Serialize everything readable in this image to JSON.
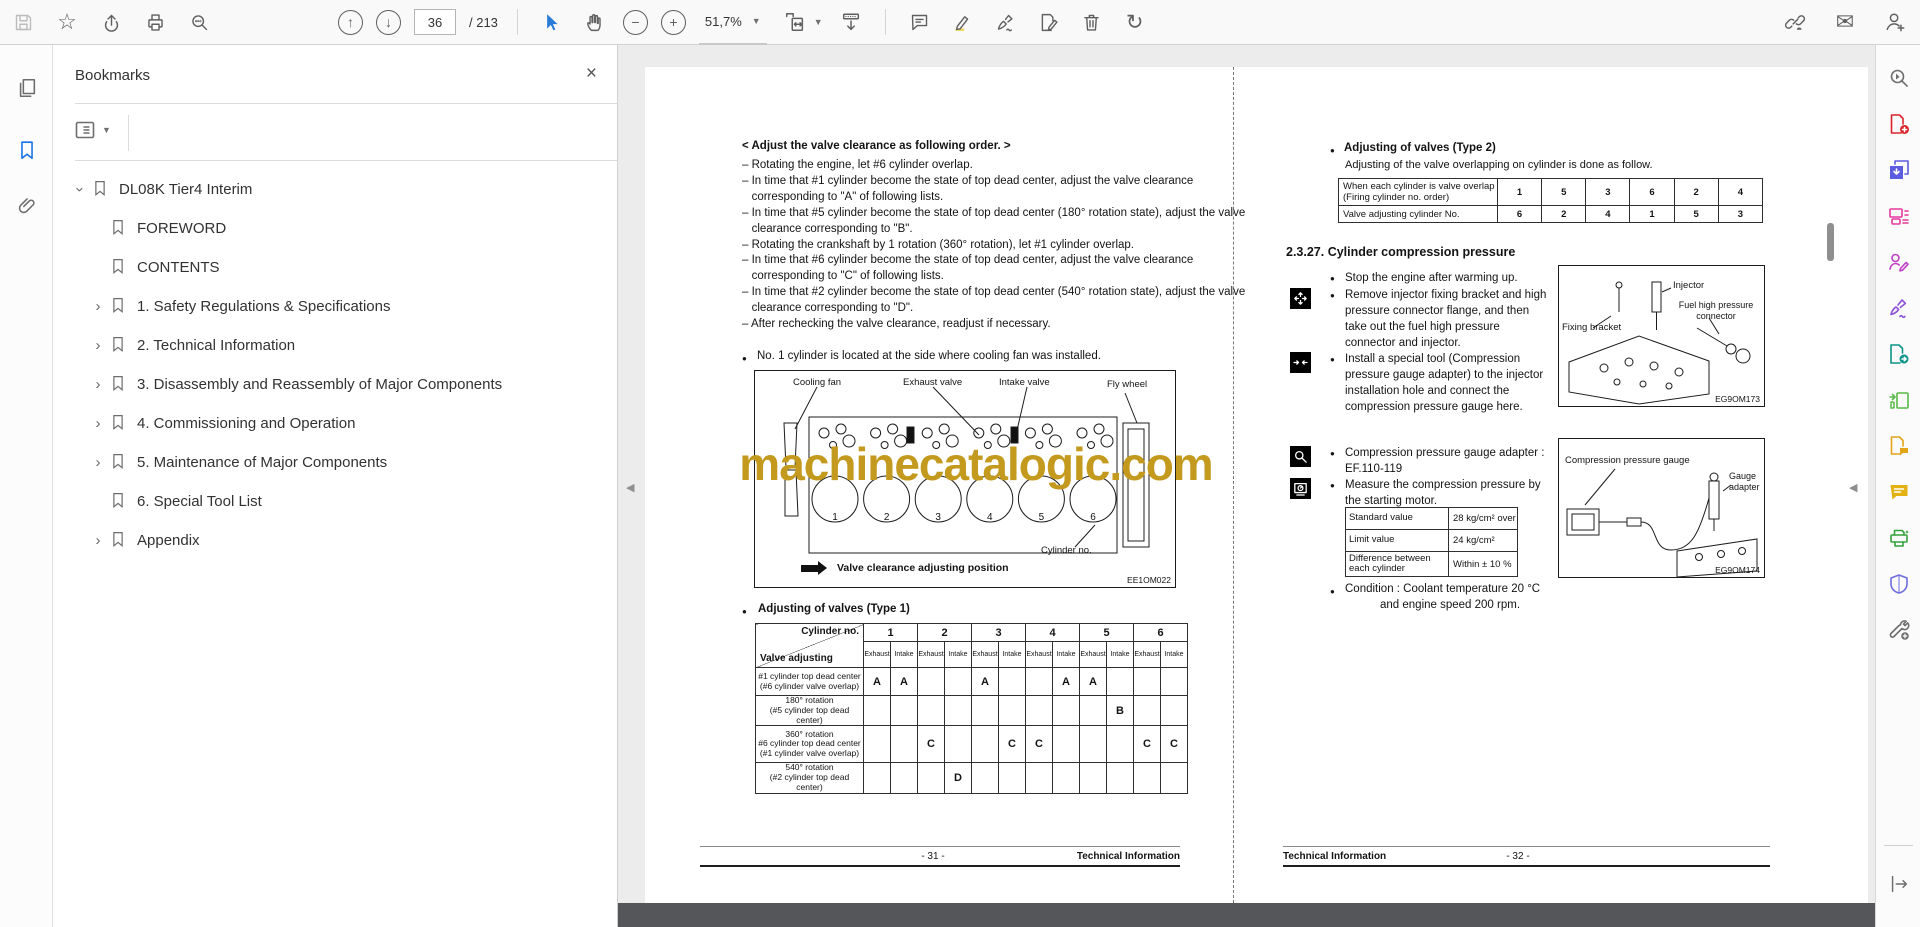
{
  "toolbar": {
    "page_current": "36",
    "page_total": "/ 213",
    "zoom_level": "51,7%",
    "left_icons": [
      "save-icon",
      "star-icon",
      "share-icon",
      "print-icon",
      "search-icon"
    ],
    "center_icons": [
      "page-up-icon",
      "page-down-icon",
      "select-tool-icon",
      "hand-tool-icon",
      "zoom-out-icon",
      "zoom-in-icon",
      "fit-width-icon",
      "scroll-mode-icon",
      "comment-icon",
      "highlight-icon",
      "sign-icon",
      "fill-sign-icon",
      "delete-icon",
      "rotate-icon"
    ],
    "right_icons": [
      "share-link-icon",
      "email-icon",
      "account-icon"
    ]
  },
  "left_rail": {
    "icons": [
      "page-thumbnails-icon",
      "bookmarks-icon",
      "attachments-icon"
    ],
    "active": "bookmarks-icon"
  },
  "bookmarks_panel": {
    "title": "Bookmarks",
    "close_label": "×",
    "items": [
      {
        "label": "DL08K Tier4 Interim",
        "chevron": "expanded",
        "indent": 0
      },
      {
        "label": "FOREWORD",
        "chevron": "none",
        "indent": 1
      },
      {
        "label": "CONTENTS",
        "chevron": "none",
        "indent": 1
      },
      {
        "label": "1. Safety Regulations & Specifications",
        "chevron": "collapsed",
        "indent": 1
      },
      {
        "label": "2. Technical Information",
        "chevron": "collapsed",
        "indent": 1
      },
      {
        "label": "3. Disassembly and Reassembly of Major Components",
        "chevron": "collapsed",
        "indent": 1
      },
      {
        "label": "4. Commissioning and Operation",
        "chevron": "collapsed",
        "indent": 1
      },
      {
        "label": "5. Maintenance of Major Components",
        "chevron": "collapsed",
        "indent": 1
      },
      {
        "label": "6. Special Tool List",
        "chevron": "none",
        "indent": 1
      },
      {
        "label": "Appendix",
        "chevron": "collapsed",
        "indent": 1
      }
    ]
  },
  "watermark": "machinecatalogic.com",
  "left_page": {
    "heading": "< Adjust the valve clearance as following order. >",
    "intro_lines": [
      "– Rotating the engine, let #6 cylinder overlap.",
      "– In time that #1 cylinder become the state of top dead center, adjust the valve clearance",
      "   corresponding to \"A\" of following lists.",
      "– In time that #5 cylinder become the state of top dead center (180° rotation state), adjust the valve",
      "   clearance corresponding to \"B\".",
      "– Rotating the crankshaft by 1 rotation (360° rotation), let #1 cylinder overlap.",
      "– In time that #6 cylinder become the state of top dead center, adjust the valve clearance",
      "   corresponding to \"C\" of following lists.",
      "– In time that #2 cylinder become the state of top dead center (540° rotation state), adjust the valve",
      "   clearance corresponding to \"D\".",
      "– After rechecking the valve clearance, readjust if necessary."
    ],
    "note": "No. 1 cylinder is located at the side where cooling fan was installed.",
    "figure": {
      "labels": {
        "cooling_fan": "Cooling fan",
        "exhaust_valve": "Exhaust valve",
        "intake_valve": "Intake valve",
        "fly_wheel": "Fly wheel",
        "cylinder_no": "Cylinder no."
      },
      "cylinder_numbers": [
        "1",
        "2",
        "3",
        "4",
        "5",
        "6"
      ],
      "caption": "Valve clearance adjusting position",
      "code": "EE1OM022"
    },
    "type1_table": {
      "title": "Adjusting of valves (Type 1)",
      "corner_top": "Cylinder no.",
      "corner_bottom": "Valve adjusting",
      "cylinders": [
        "1",
        "2",
        "3",
        "4",
        "5",
        "6"
      ],
      "subheaders": [
        "Exhaust",
        "Intake"
      ],
      "rows": [
        {
          "label_lines": [
            "#1 cylinder top dead center",
            "(#6 cylinder valve overlap)"
          ],
          "marks": [
            "A",
            "A",
            "",
            "",
            "A",
            "",
            "",
            "A",
            "A",
            "",
            "",
            ""
          ]
        },
        {
          "label_lines": [
            "180° rotation",
            "(#5 cylinder top dead center)"
          ],
          "marks": [
            "",
            "",
            "",
            "",
            "",
            "",
            "",
            "",
            "",
            "B",
            "",
            ""
          ]
        },
        {
          "label_lines": [
            "360° rotation",
            "#6 cylinder top dead center",
            "(#1 cylinder valve overlap)"
          ],
          "marks": [
            "",
            "",
            "C",
            "",
            "",
            "C",
            "C",
            "",
            "",
            "",
            "C",
            "C"
          ]
        },
        {
          "label_lines": [
            "540° rotation",
            "(#2 cylinder top dead center)"
          ],
          "marks": [
            "",
            "",
            "",
            "D",
            "",
            "",
            "",
            "",
            "",
            "",
            "",
            ""
          ]
        }
      ]
    },
    "footer": {
      "page": "- 31 -",
      "section": "Technical Information"
    }
  },
  "right_page": {
    "type2": {
      "title": "Adjusting of valves (Type 2)",
      "subtitle": "Adjusting of the valve overlapping on cylinder is done as follow.",
      "row1_label_lines": [
        "When each cylinder is valve overlap",
        "(Firing cylinder no. order)"
      ],
      "row1_values": [
        "1",
        "5",
        "3",
        "6",
        "2",
        "4"
      ],
      "row2_label": "Valve adjusting cylinder No.",
      "row2_values": [
        "6",
        "2",
        "4",
        "1",
        "5",
        "3"
      ]
    },
    "section": {
      "heading": "2.3.27. Cylinder compression pressure",
      "steps": [
        {
          "icon": "",
          "lines": [
            "Stop the engine after warming up."
          ]
        },
        {
          "icon": "disassemble-icon",
          "lines": [
            "Remove injector fixing bracket and high",
            "pressure connector flange, and then",
            "take out the fuel high pressure",
            "connector and injector."
          ]
        },
        {
          "icon": "assemble-icon",
          "lines": [
            "Install a special tool (Compression",
            "pressure gauge adapter) to the injector",
            "installation hole and connect the",
            "compression pressure gauge here."
          ]
        },
        {
          "icon": "inspect-icon",
          "lines": [
            "Compression pressure gauge adapter :",
            "EF.110-119"
          ]
        },
        {
          "icon": "measure-icon",
          "lines": [
            "Measure the compression pressure by",
            "the starting motor."
          ]
        }
      ],
      "pressure_table": {
        "rows": [
          [
            "Standard value",
            "28 kg/cm² over"
          ],
          [
            "Limit value",
            "24 kg/cm²"
          ],
          [
            "Difference between each cylinder",
            "Within ± 10 %"
          ]
        ]
      },
      "condition_lines": [
        "Condition : Coolant temperature 20 °C",
        "and engine speed 200 rpm."
      ]
    },
    "figure1": {
      "labels": {
        "injector": "Injector",
        "fuel_connector_line1": "Fuel high pressure",
        "fuel_connector_line2": "connector",
        "fixing_bracket": "Fixing bracket"
      },
      "code": "EG9OM173"
    },
    "figure2": {
      "labels": {
        "gauge": "Compression pressure gauge",
        "adapter_line1": "Gauge",
        "adapter_line2": "adapter"
      },
      "code": "EG9OM174"
    },
    "footer": {
      "section": "Technical Information",
      "page": "- 32 -"
    }
  },
  "right_rail": {
    "icons": [
      "search-tools-icon",
      "create-pdf-icon",
      "combine-files-icon",
      "organize-pages-icon",
      "request-signatures-icon",
      "fill-and-sign-icon",
      "export-pdf-icon",
      "edit-pdf-icon",
      "send-for-comments-icon",
      "comment-tool-icon",
      "scan-ocr-icon",
      "protect-icon",
      "more-tools-icon"
    ],
    "expand_icon": "expand-pane-icon"
  }
}
